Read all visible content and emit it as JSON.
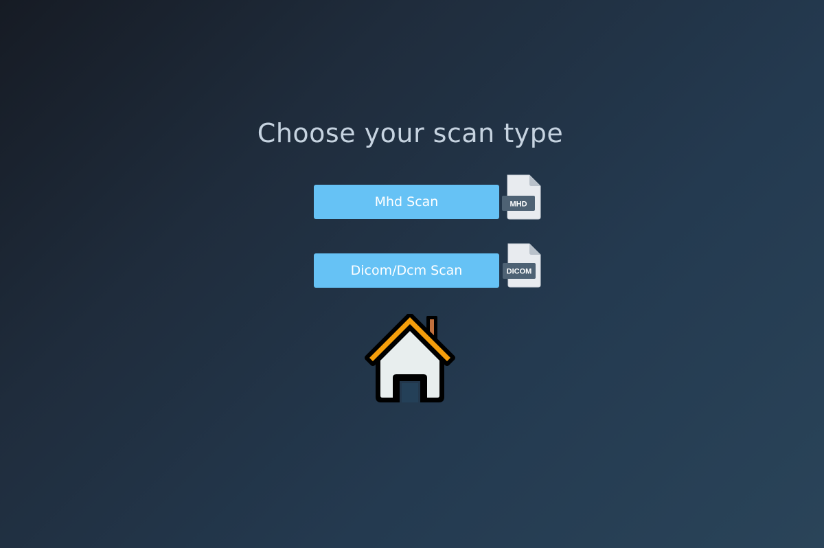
{
  "page": {
    "title": "Choose your scan type"
  },
  "scans": {
    "mhd": {
      "button_label": "Mhd Scan",
      "icon_label": "MHD",
      "icon": "mhd-file-icon"
    },
    "dicom": {
      "button_label": "Dicom/Dcm Scan",
      "icon_label": "DICOM",
      "icon": "dicom-file-icon"
    }
  },
  "home": {
    "icon": "home-icon"
  },
  "colors": {
    "button_bg": "#66c2f5",
    "button_text": "#ffffff",
    "title_text": "#c6d3e0",
    "roof": "#f59e0b",
    "chimney": "#c2703d"
  }
}
